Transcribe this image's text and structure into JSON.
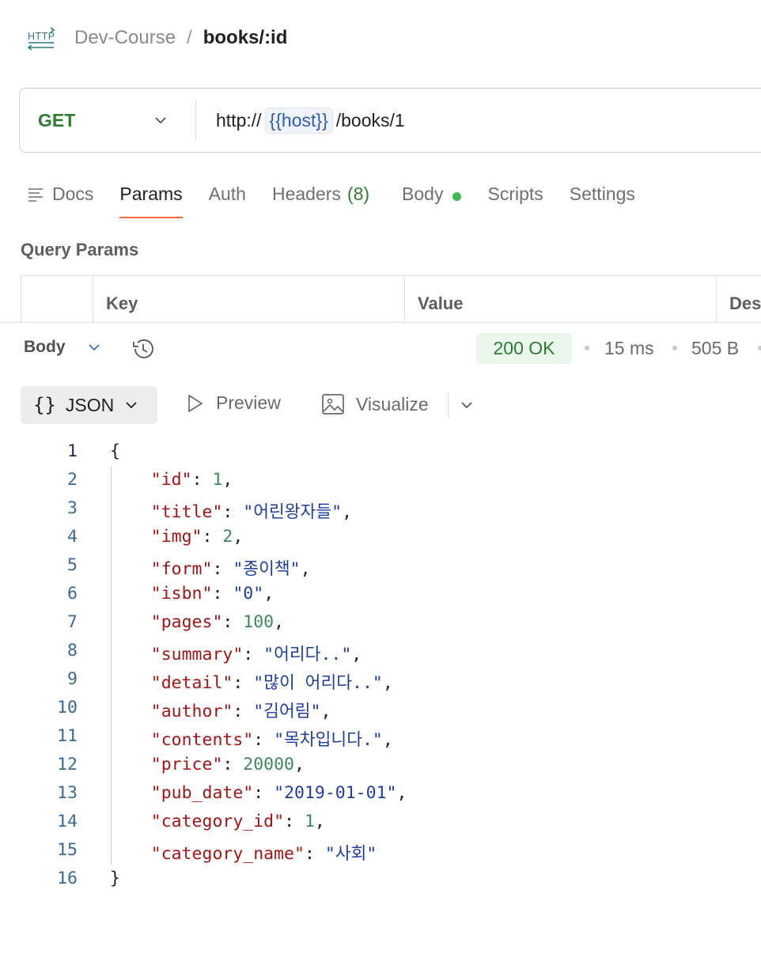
{
  "breadcrumb": {
    "icon": "http-icon",
    "parent": "Dev-Course",
    "separator": "/",
    "current": "books/:id"
  },
  "request": {
    "method": "GET",
    "url_prefix": "http://",
    "url_variable": "{{host}}",
    "url_suffix": "/books/1"
  },
  "tabs": [
    {
      "label": "Docs"
    },
    {
      "label": "Params"
    },
    {
      "label": "Auth"
    },
    {
      "label": "Headers",
      "count": "(8)"
    },
    {
      "label": "Body"
    },
    {
      "label": "Scripts"
    },
    {
      "label": "Settings"
    }
  ],
  "active_tab": "Params",
  "query_params": {
    "title": "Query Params",
    "columns": [
      "Key",
      "Value",
      "Des"
    ]
  },
  "response": {
    "body_label": "Body",
    "status": "200 OK",
    "time": "15 ms",
    "size": "505 B",
    "colors": {
      "status_bg": "#e9f6ec",
      "status_text": "#2e7d32"
    }
  },
  "format_toolbar": {
    "format": "JSON",
    "preview": "Preview",
    "visualize": "Visualize"
  },
  "json_lines": [
    {
      "n": "1",
      "parts": [
        {
          "t": "{",
          "c": "punc"
        }
      ]
    },
    {
      "n": "2",
      "parts": [
        {
          "t": "    ",
          "c": "punc"
        },
        {
          "t": "\"id\"",
          "c": "key"
        },
        {
          "t": ": ",
          "c": "punc"
        },
        {
          "t": "1",
          "c": "num"
        },
        {
          "t": ",",
          "c": "punc"
        }
      ]
    },
    {
      "n": "3",
      "parts": [
        {
          "t": "    ",
          "c": "punc"
        },
        {
          "t": "\"title\"",
          "c": "key"
        },
        {
          "t": ": ",
          "c": "punc"
        },
        {
          "t": "\"어린왕자들\"",
          "c": "str"
        },
        {
          "t": ",",
          "c": "punc"
        }
      ]
    },
    {
      "n": "4",
      "parts": [
        {
          "t": "    ",
          "c": "punc"
        },
        {
          "t": "\"img\"",
          "c": "key"
        },
        {
          "t": ": ",
          "c": "punc"
        },
        {
          "t": "2",
          "c": "num"
        },
        {
          "t": ",",
          "c": "punc"
        }
      ]
    },
    {
      "n": "5",
      "parts": [
        {
          "t": "    ",
          "c": "punc"
        },
        {
          "t": "\"form\"",
          "c": "key"
        },
        {
          "t": ": ",
          "c": "punc"
        },
        {
          "t": "\"종이책\"",
          "c": "str"
        },
        {
          "t": ",",
          "c": "punc"
        }
      ]
    },
    {
      "n": "6",
      "parts": [
        {
          "t": "    ",
          "c": "punc"
        },
        {
          "t": "\"isbn\"",
          "c": "key"
        },
        {
          "t": ": ",
          "c": "punc"
        },
        {
          "t": "\"0\"",
          "c": "str"
        },
        {
          "t": ",",
          "c": "punc"
        }
      ]
    },
    {
      "n": "7",
      "parts": [
        {
          "t": "    ",
          "c": "punc"
        },
        {
          "t": "\"pages\"",
          "c": "key"
        },
        {
          "t": ": ",
          "c": "punc"
        },
        {
          "t": "100",
          "c": "num"
        },
        {
          "t": ",",
          "c": "punc"
        }
      ]
    },
    {
      "n": "8",
      "parts": [
        {
          "t": "    ",
          "c": "punc"
        },
        {
          "t": "\"summary\"",
          "c": "key"
        },
        {
          "t": ": ",
          "c": "punc"
        },
        {
          "t": "\"어리다..\"",
          "c": "str"
        },
        {
          "t": ",",
          "c": "punc"
        }
      ]
    },
    {
      "n": "9",
      "parts": [
        {
          "t": "    ",
          "c": "punc"
        },
        {
          "t": "\"detail\"",
          "c": "key"
        },
        {
          "t": ": ",
          "c": "punc"
        },
        {
          "t": "\"많이 어리다..\"",
          "c": "str"
        },
        {
          "t": ",",
          "c": "punc"
        }
      ]
    },
    {
      "n": "10",
      "parts": [
        {
          "t": "    ",
          "c": "punc"
        },
        {
          "t": "\"author\"",
          "c": "key"
        },
        {
          "t": ": ",
          "c": "punc"
        },
        {
          "t": "\"김어림\"",
          "c": "str"
        },
        {
          "t": ",",
          "c": "punc"
        }
      ]
    },
    {
      "n": "11",
      "parts": [
        {
          "t": "    ",
          "c": "punc"
        },
        {
          "t": "\"contents\"",
          "c": "key"
        },
        {
          "t": ": ",
          "c": "punc"
        },
        {
          "t": "\"목차입니다.\"",
          "c": "str"
        },
        {
          "t": ",",
          "c": "punc"
        }
      ]
    },
    {
      "n": "12",
      "parts": [
        {
          "t": "    ",
          "c": "punc"
        },
        {
          "t": "\"price\"",
          "c": "key"
        },
        {
          "t": ": ",
          "c": "punc"
        },
        {
          "t": "20000",
          "c": "num"
        },
        {
          "t": ",",
          "c": "punc"
        }
      ]
    },
    {
      "n": "13",
      "parts": [
        {
          "t": "    ",
          "c": "punc"
        },
        {
          "t": "\"pub_date\"",
          "c": "key"
        },
        {
          "t": ": ",
          "c": "punc"
        },
        {
          "t": "\"2019-01-01\"",
          "c": "str"
        },
        {
          "t": ",",
          "c": "punc"
        }
      ]
    },
    {
      "n": "14",
      "parts": [
        {
          "t": "    ",
          "c": "punc"
        },
        {
          "t": "\"category_id\"",
          "c": "key"
        },
        {
          "t": ": ",
          "c": "punc"
        },
        {
          "t": "1",
          "c": "num"
        },
        {
          "t": ",",
          "c": "punc"
        }
      ]
    },
    {
      "n": "15",
      "parts": [
        {
          "t": "    ",
          "c": "punc"
        },
        {
          "t": "\"category_name\"",
          "c": "key"
        },
        {
          "t": ": ",
          "c": "punc"
        },
        {
          "t": "\"사회\"",
          "c": "str"
        }
      ]
    },
    {
      "n": "16",
      "parts": [
        {
          "t": "}",
          "c": "punc"
        }
      ]
    }
  ]
}
